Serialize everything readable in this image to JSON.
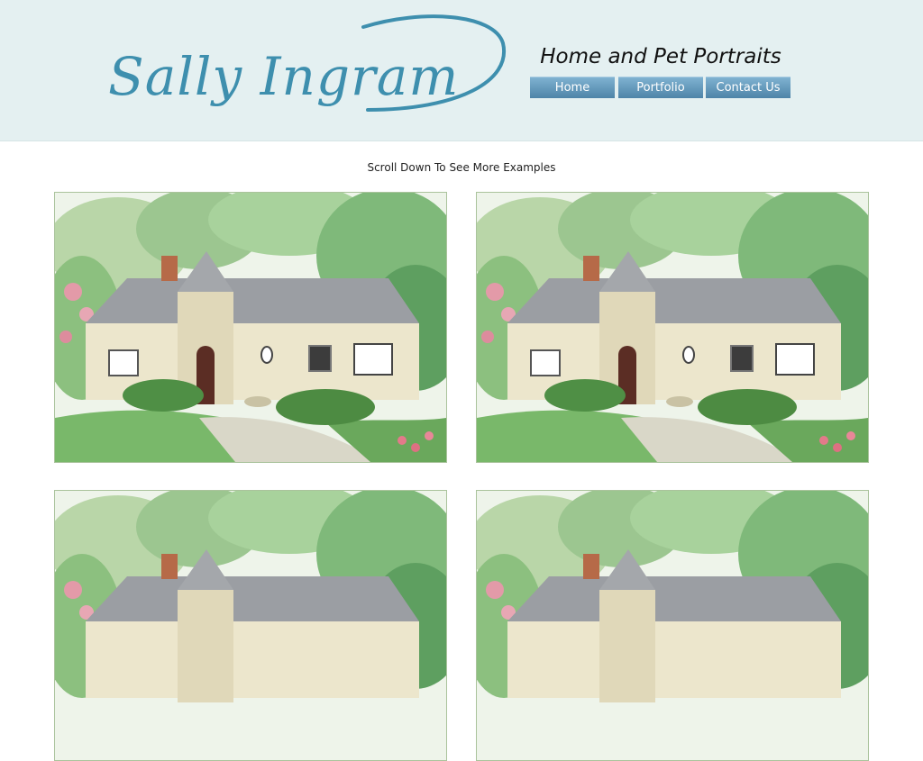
{
  "brand": {
    "logo_text": "Sally Ingram",
    "tagline": "Home and Pet Portraits"
  },
  "nav": {
    "items": [
      {
        "label": "Home"
      },
      {
        "label": "Portfolio"
      },
      {
        "label": "Contact Us"
      }
    ]
  },
  "main": {
    "scroll_note": "Scroll Down To See More Examples"
  },
  "colors": {
    "header_bg": "#e4f0f1",
    "logo": "#3e8fae",
    "nav_button": "#5e93b6"
  }
}
